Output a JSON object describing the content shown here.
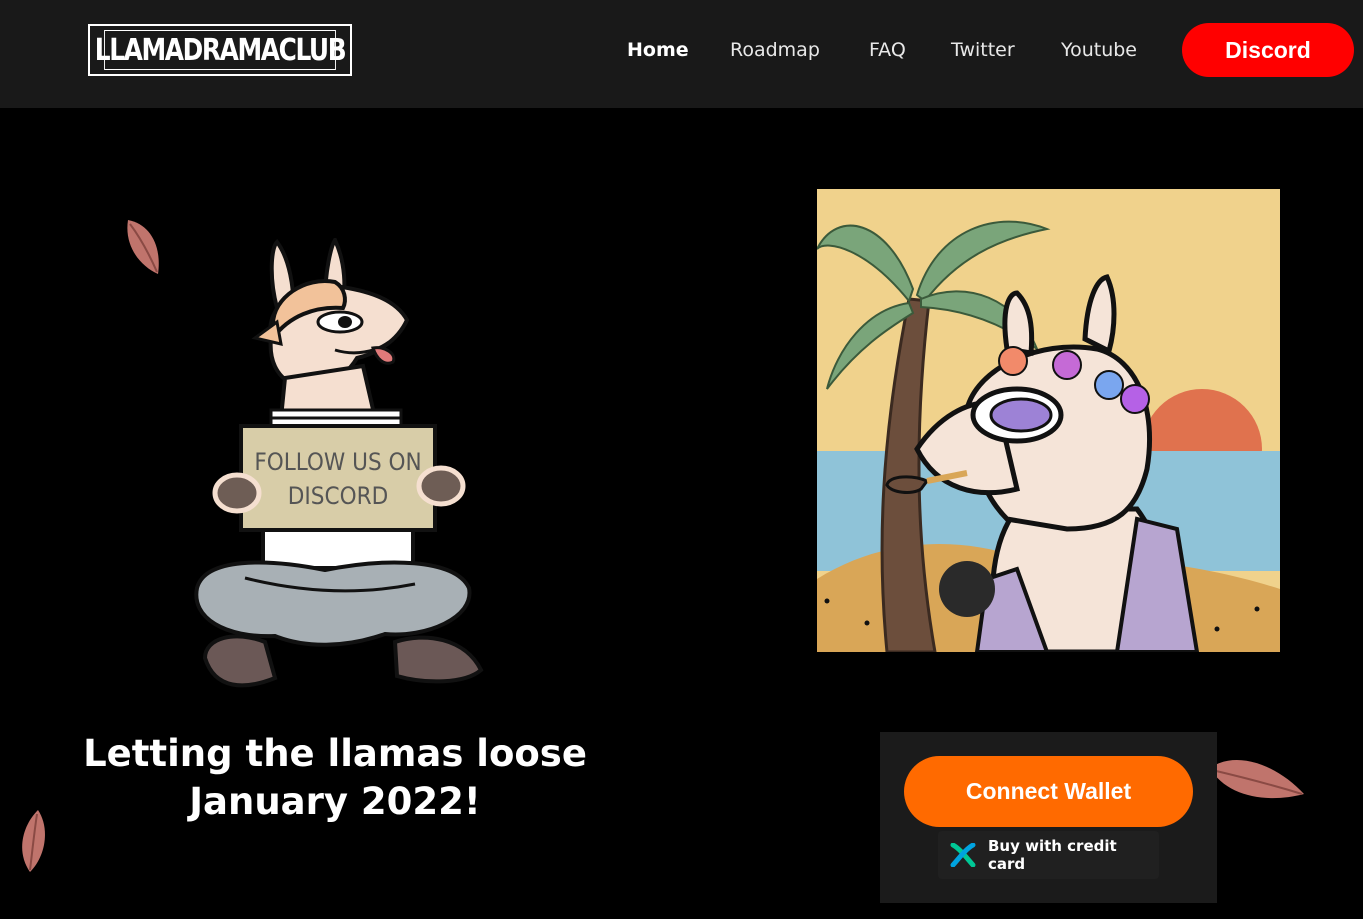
{
  "brand": {
    "logo_text": "LLAMADRAMACLUB"
  },
  "nav": {
    "items": [
      {
        "label": "Home",
        "active": true
      },
      {
        "label": "Roadmap"
      },
      {
        "label": "FAQ"
      },
      {
        "label": "Twitter"
      },
      {
        "label": "Youtube"
      }
    ],
    "discord_label": "Discord"
  },
  "hero": {
    "line1": "Letting the llamas loose",
    "line2": "January 2022!",
    "sign_line1": "FOLLOW US ON",
    "sign_line2": "DISCORD"
  },
  "wallet": {
    "connect_label": "Connect Wallet",
    "credit_label": "Buy with credit card"
  },
  "colors": {
    "discord": "#ff0000",
    "connect": "#ff6a00",
    "topbar": "#191919",
    "leaf": "#c0746c"
  },
  "icons": [
    "crossmint-x-icon",
    "leaf-icon"
  ]
}
